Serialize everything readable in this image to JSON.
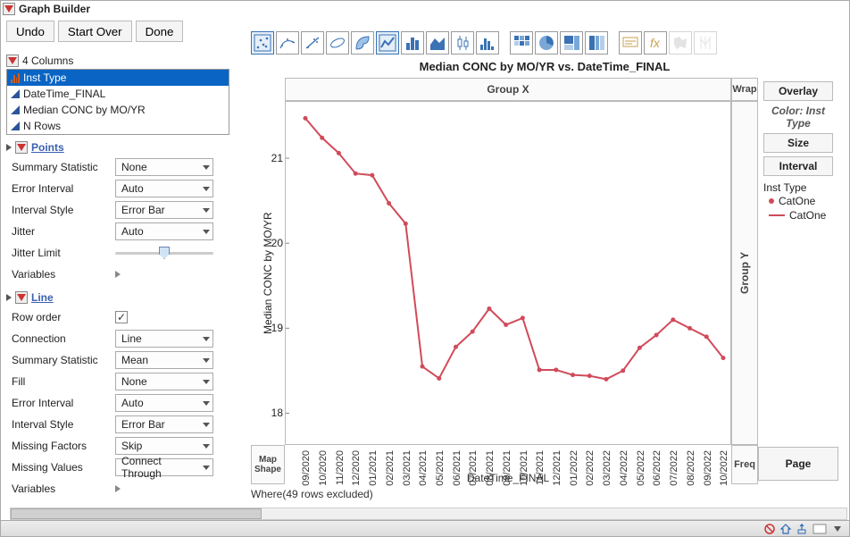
{
  "window": {
    "title": "Graph Builder",
    "buttons": {
      "undo": "Undo",
      "start_over": "Start Over",
      "done": "Done"
    },
    "columns_header": "4 Columns",
    "columns": [
      {
        "name": "Inst Type",
        "icon": "nominal",
        "selected": true
      },
      {
        "name": "DateTime_FINAL",
        "icon": "cont",
        "selected": false
      },
      {
        "name": "Median CONC by MO/YR",
        "icon": "cont",
        "selected": false
      },
      {
        "name": "N Rows",
        "icon": "cont",
        "selected": false
      }
    ]
  },
  "points": {
    "header": "Points",
    "summary_stat": {
      "label": "Summary Statistic",
      "value": "None"
    },
    "error_interval": {
      "label": "Error Interval",
      "value": "Auto"
    },
    "interval_style": {
      "label": "Interval Style",
      "value": "Error Bar"
    },
    "jitter": {
      "label": "Jitter",
      "value": "Auto"
    },
    "jitter_limit": {
      "label": "Jitter Limit"
    },
    "variables": {
      "label": "Variables"
    }
  },
  "line": {
    "header": "Line",
    "row_order": {
      "label": "Row order",
      "checked": true
    },
    "connection": {
      "label": "Connection",
      "value": "Line"
    },
    "summary_stat": {
      "label": "Summary Statistic",
      "value": "Mean"
    },
    "fill": {
      "label": "Fill",
      "value": "None"
    },
    "error_interval": {
      "label": "Error Interval",
      "value": "Auto"
    },
    "interval_style": {
      "label": "Interval Style",
      "value": "Error Bar"
    },
    "missing_factors": {
      "label": "Missing Factors",
      "value": "Skip"
    },
    "missing_values": {
      "label": "Missing Values",
      "value": "Connect Through"
    },
    "variables": {
      "label": "Variables"
    }
  },
  "chart": {
    "title": "Median CONC by MO/YR vs. DateTime_FINAL",
    "x_label": "DateTime_FINAL",
    "y_label": "Median CONC by MO/YR",
    "zones": {
      "groupx": "Group X",
      "groupy": "Group Y",
      "wrap": "Wrap",
      "overlay": "Overlay",
      "color": "Color: Inst Type",
      "size": "Size",
      "interval": "Interval",
      "freq": "Freq",
      "page": "Page",
      "map": "Map Shape"
    },
    "y_ticks": [
      18,
      19,
      20,
      21
    ],
    "legend_title": "Inst Type",
    "legend_items": [
      {
        "kind": "point",
        "label": "CatOne"
      },
      {
        "kind": "line",
        "label": "CatOne"
      }
    ]
  },
  "chart_data": {
    "type": "line",
    "title": "Median CONC by MO/YR vs. DateTime_FINAL",
    "xlabel": "DateTime_FINAL",
    "ylabel": "Median CONC by MO/YR",
    "ylim": [
      17.7,
      21.6
    ],
    "categories": [
      "09/2020",
      "10/2020",
      "11/2020",
      "12/2020",
      "01/2021",
      "02/2021",
      "03/2021",
      "04/2021",
      "05/2021",
      "06/2021",
      "07/2021",
      "08/2021",
      "09/2021",
      "10/2021",
      "11/2021",
      "12/2021",
      "01/2022",
      "02/2022",
      "03/2022",
      "04/2022",
      "05/2022",
      "06/2022",
      "07/2022",
      "08/2022",
      "09/2022",
      "10/2022"
    ],
    "series": [
      {
        "name": "CatOne",
        "values": [
          21.47,
          21.24,
          21.06,
          20.82,
          20.8,
          20.47,
          20.23,
          18.55,
          18.41,
          18.78,
          18.96,
          19.23,
          19.04,
          19.12,
          18.51,
          18.51,
          18.45,
          18.44,
          18.4,
          18.5,
          18.77,
          18.92,
          19.1,
          19.0,
          18.9,
          18.65
        ]
      }
    ]
  },
  "where_note": "Where(49 rows excluded)",
  "status": {
    "err": "error",
    "home": "home",
    "up": "upload",
    "box": ""
  }
}
